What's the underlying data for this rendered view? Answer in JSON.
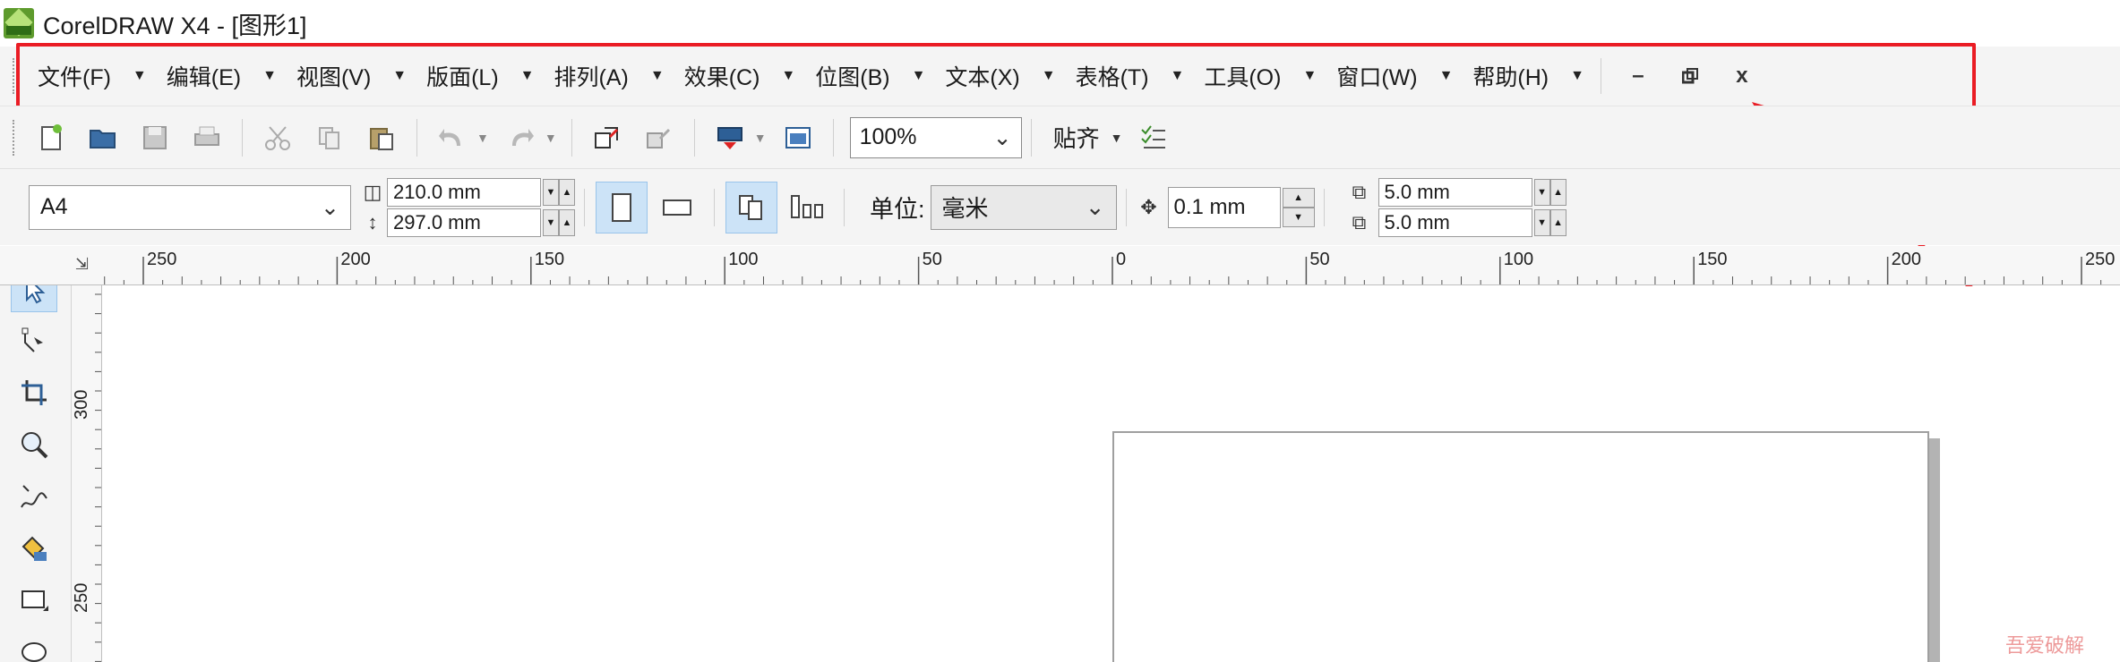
{
  "window": {
    "title": "CorelDRAW X4 - [图形1]"
  },
  "menu": {
    "items": [
      {
        "label": "文件(F)",
        "name": "menu-file"
      },
      {
        "label": "编辑(E)",
        "name": "menu-edit"
      },
      {
        "label": "视图(V)",
        "name": "menu-view"
      },
      {
        "label": "版面(L)",
        "name": "menu-layout"
      },
      {
        "label": "排列(A)",
        "name": "menu-arrange"
      },
      {
        "label": "效果(C)",
        "name": "menu-effects"
      },
      {
        "label": "位图(B)",
        "name": "menu-bitmaps"
      },
      {
        "label": "文本(X)",
        "name": "menu-text"
      },
      {
        "label": "表格(T)",
        "name": "menu-table"
      },
      {
        "label": "工具(O)",
        "name": "menu-tools"
      },
      {
        "label": "窗口(W)",
        "name": "menu-window"
      },
      {
        "label": "帮助(H)",
        "name": "menu-help"
      }
    ],
    "minimize": "–",
    "restore": "▫",
    "close": "x"
  },
  "toolbar": {
    "zoom": "100%",
    "snap": "贴齐"
  },
  "properties": {
    "page_size": "A4",
    "width": "210.0 mm",
    "height": "297.0 mm",
    "unit_label": "单位:",
    "unit_value": "毫米",
    "nudge": "0.1 mm",
    "dup_x": "5.0 mm",
    "dup_y": "5.0 mm"
  },
  "ruler": {
    "horizontal": [
      "250",
      "200",
      "150",
      "100",
      "50",
      "0",
      "50",
      "100",
      "150",
      "200",
      "250"
    ],
    "vertical": [
      "300",
      "250"
    ]
  },
  "watermark": "吾爱破解"
}
